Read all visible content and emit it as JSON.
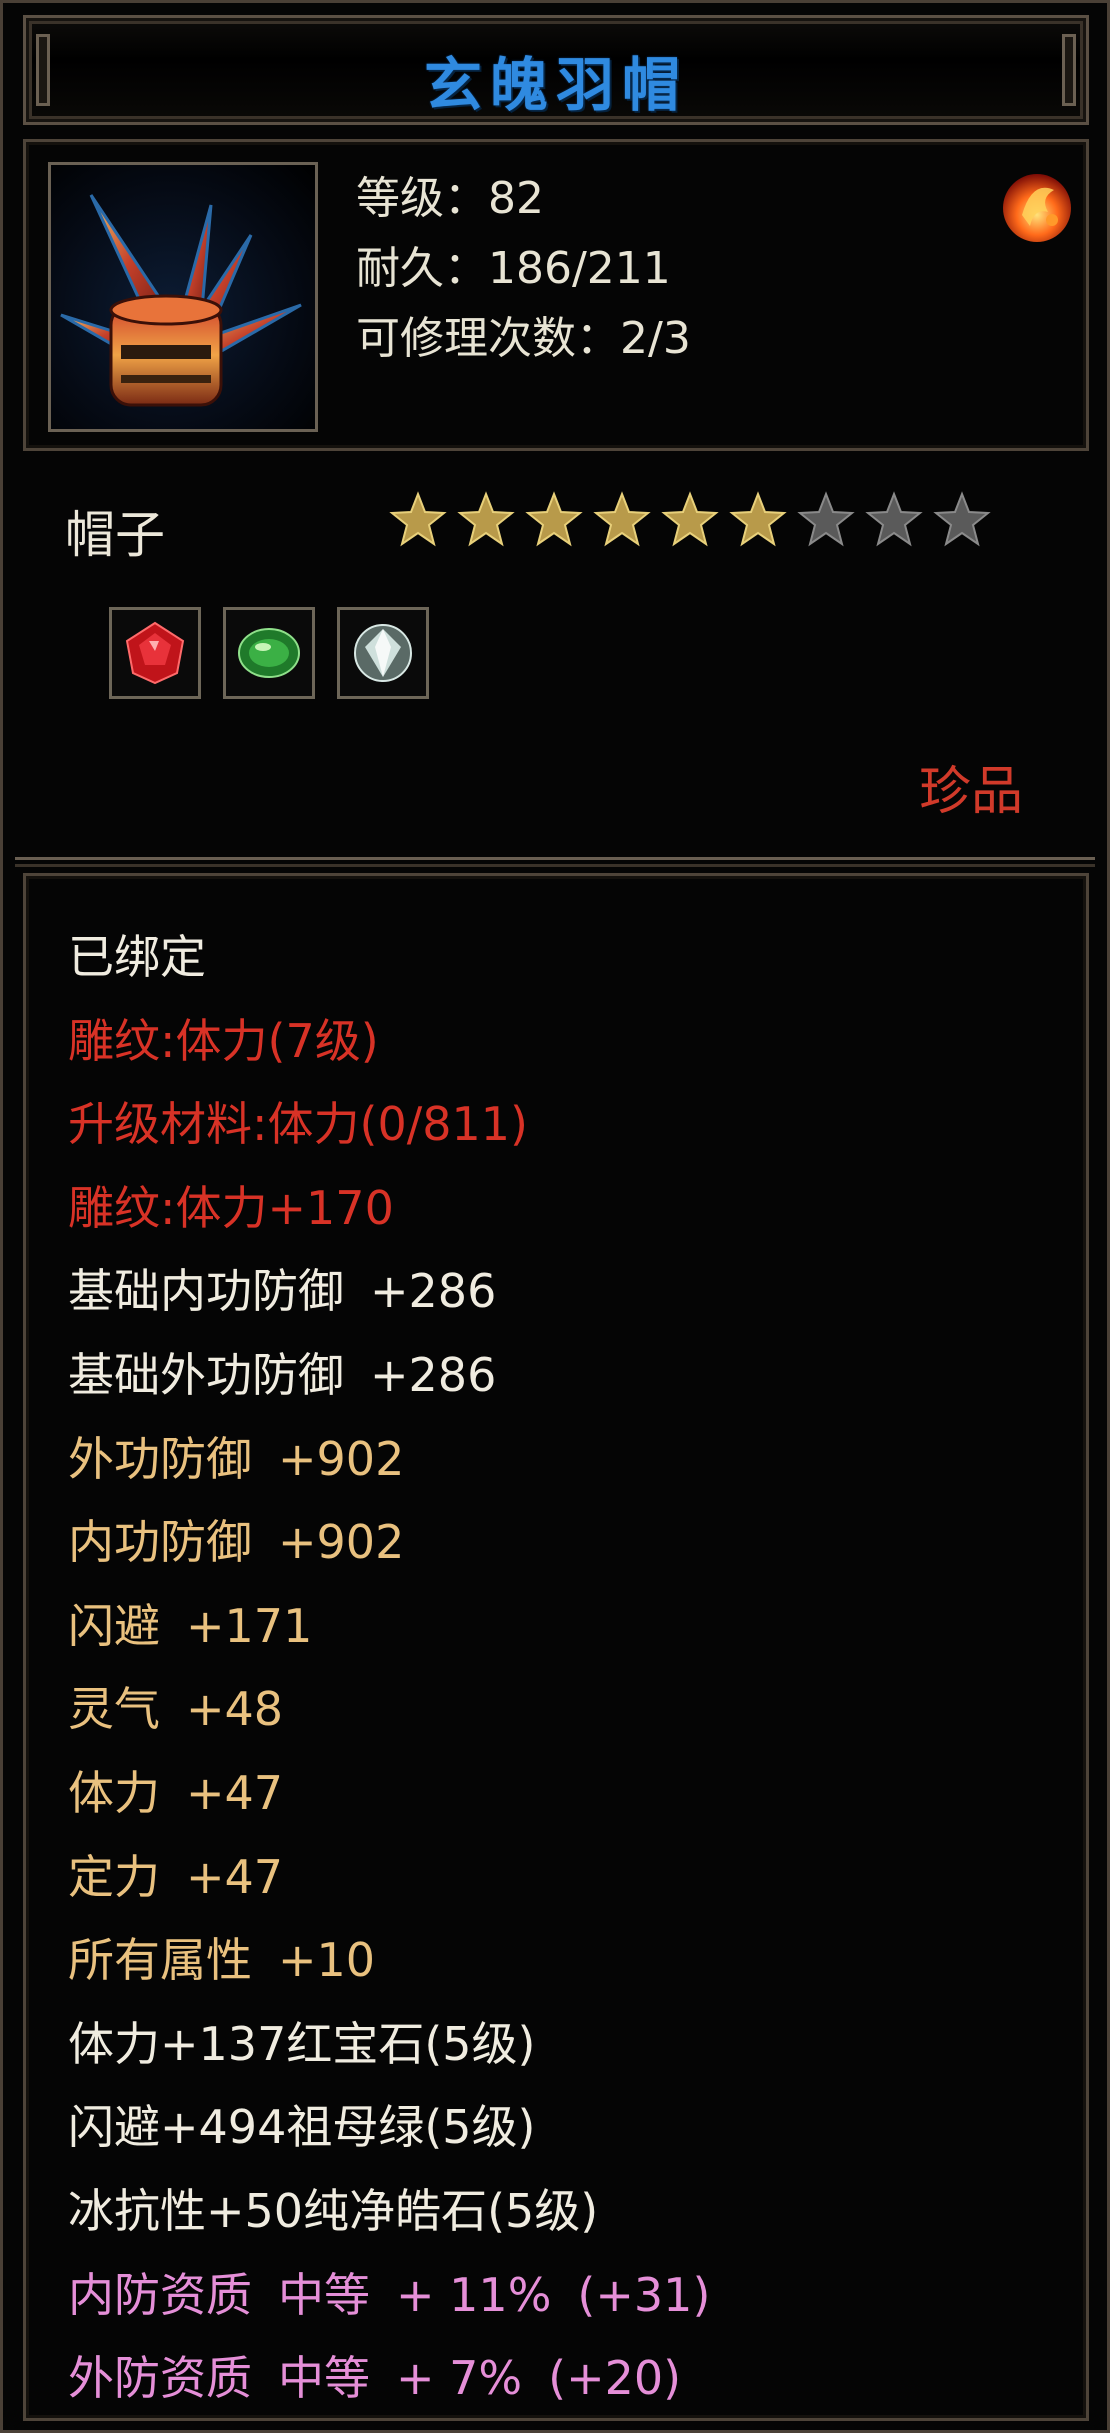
{
  "item": {
    "name": "玄魄羽帽",
    "level_line": "等级：82",
    "durability_line": "耐久：186/211",
    "repair_line": "可修理次数：2/3",
    "type": "帽子",
    "stars_filled": 6,
    "stars_total": 9,
    "rarity": "珍品"
  },
  "gems": [
    "red-ruby-gem-icon",
    "green-emerald-gem-icon",
    "white-diamond-gem-icon"
  ],
  "attributes": [
    {
      "text": "已绑定",
      "color": "white"
    },
    {
      "text": "雕纹:体力(7级)",
      "color": "red"
    },
    {
      "text": "升级材料:体力(0/811)",
      "color": "red"
    },
    {
      "text": "雕纹:体力+170",
      "color": "red"
    },
    {
      "label": "基础内功防御",
      "value": "+286",
      "color": "white"
    },
    {
      "label": "基础外功防御",
      "value": "+286",
      "color": "white"
    },
    {
      "label": "外功防御",
      "value": "+902",
      "color": "gold"
    },
    {
      "label": "内功防御",
      "value": "+902",
      "color": "gold"
    },
    {
      "label": "闪避",
      "value": "+171",
      "color": "gold"
    },
    {
      "label": "灵气",
      "value": "+48",
      "color": "gold"
    },
    {
      "label": "体力",
      "value": "+47",
      "color": "gold"
    },
    {
      "label": "定力",
      "value": "+47",
      "color": "gold"
    },
    {
      "label": "所有属性",
      "value": "+10",
      "color": "gold"
    },
    {
      "text": "体力+137红宝石(5级)",
      "color": "white"
    },
    {
      "text": "闪避+494祖母绿(5级)",
      "color": "white"
    },
    {
      "text": "冰抗性+50纯净皓石(5级)",
      "color": "white"
    },
    {
      "label": "内防资质",
      "grade": "中等",
      "pct": "+ 11%",
      "bonus": "(+31)",
      "color": "pink"
    },
    {
      "label": "外防资质",
      "grade": "中等",
      "pct": "+ 7%",
      "bonus": "(+20)",
      "color": "pink"
    }
  ],
  "colors": {
    "title": "#2f8ae0",
    "white": "#f0ece0",
    "red": "#d83226",
    "gold": "#e9c17f",
    "pink": "#e58fd8",
    "star_filled": "#b89a4a",
    "star_empty": "#5a5a5a"
  }
}
